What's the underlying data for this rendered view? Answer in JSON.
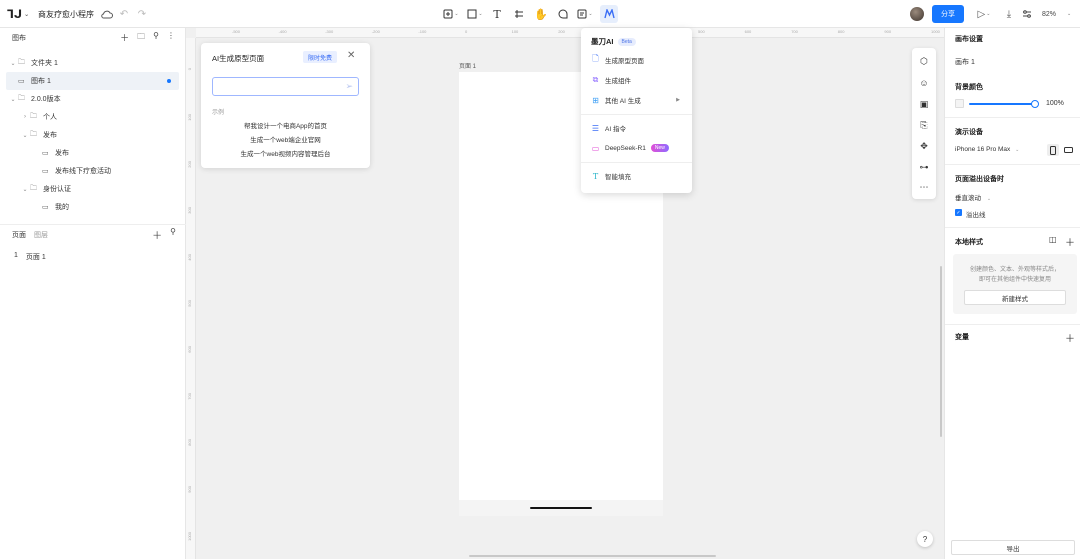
{
  "topbar": {
    "logo": "ᒣᒍ",
    "project_title": "商友疗愈小程序",
    "share_label": "分享",
    "zoom": "82%"
  },
  "left_panel": {
    "title": "图布",
    "tree": [
      {
        "label": "文件夹 1",
        "level": 0,
        "caret": "⌄",
        "icon": "folder-icon",
        "selected": false
      },
      {
        "label": "图布 1",
        "level": 0,
        "caret": "",
        "icon": "frame-icon",
        "selected": true
      },
      {
        "label": "2.0.0版本",
        "level": 0,
        "caret": "⌄",
        "icon": "folder-icon",
        "selected": false
      },
      {
        "label": "个人",
        "level": 1,
        "caret": "›",
        "icon": "folder-icon",
        "selected": false
      },
      {
        "label": "发布",
        "level": 1,
        "caret": "⌄",
        "icon": "folder-icon",
        "selected": false
      },
      {
        "label": "发布",
        "level": 2,
        "caret": "",
        "icon": "frame-icon",
        "selected": false
      },
      {
        "label": "发布线下疗愈活动",
        "level": 2,
        "caret": "",
        "icon": "frame-icon",
        "selected": false
      },
      {
        "label": "身份认证",
        "level": 1,
        "caret": "⌄",
        "icon": "folder-icon",
        "selected": false
      },
      {
        "label": "我的",
        "level": 2,
        "caret": "",
        "icon": "frame-icon",
        "selected": false
      }
    ],
    "pages_tab": "页面",
    "layers_tab": "图层",
    "page_rows": [
      {
        "num": "1",
        "label": "页面 1"
      }
    ]
  },
  "canvas": {
    "ruler_h": [
      "-500",
      "-400",
      "-300",
      "-200",
      "-100",
      "0",
      "100",
      "200",
      "300",
      "400",
      "500",
      "600",
      "700",
      "800",
      "900",
      "1000"
    ],
    "ruler_v": [
      "0",
      "100",
      "200",
      "300",
      "400",
      "500",
      "600",
      "700",
      "800",
      "900",
      "1000"
    ],
    "frame_label": "页面 1"
  },
  "ai_card": {
    "title": "AI生成原型页面",
    "badge": "限时免费",
    "input_placeholder": "",
    "examples_label": "示例",
    "examples": [
      "帮我设计一个电商App的首页",
      "生成一个web端企业官网",
      "生成一个web视频内容管理后台"
    ]
  },
  "ai_menu": {
    "title": "墨刀AI",
    "beta": "Beta",
    "items": [
      {
        "label": "生成原型页面",
        "icon": "page-icon",
        "color": "#3b6ef5"
      },
      {
        "label": "生成组件",
        "icon": "component-icon",
        "color": "#8e6bff"
      },
      {
        "label": "其他 AI 生成",
        "icon": "grid-icon",
        "color": "#3b9ef5",
        "submenu": true
      },
      {
        "label": "AI 指令",
        "icon": "command-icon",
        "color": "#3b6ef5"
      },
      {
        "label": "DeepSeek-R1",
        "icon": "chat-icon",
        "color": "#e04fd6",
        "badge": "New"
      },
      {
        "label": "智能填充",
        "icon": "text-fill-icon",
        "color": "#2bb5c9"
      }
    ]
  },
  "right_panel": {
    "canvas_settings": "画布设置",
    "canvas_name": "画布 1",
    "bg_color_label": "背景颜色",
    "bg_opacity": "100%",
    "device_label": "演示设备",
    "device_value": "iPhone 16 Pro Max",
    "overflow_label": "页面溢出设备时",
    "scroll_value": "垂直滚动",
    "overflow_line_label": "溢出线",
    "local_styles_label": "本地样式",
    "local_desc_1": "创建颜色、文本、外观等样式后，",
    "local_desc_2": "即可在其他组件中快速复用",
    "new_style_label": "新建样式",
    "variables_label": "变量",
    "export_label": "导出"
  },
  "colors": {
    "accent": "#1677ff"
  }
}
